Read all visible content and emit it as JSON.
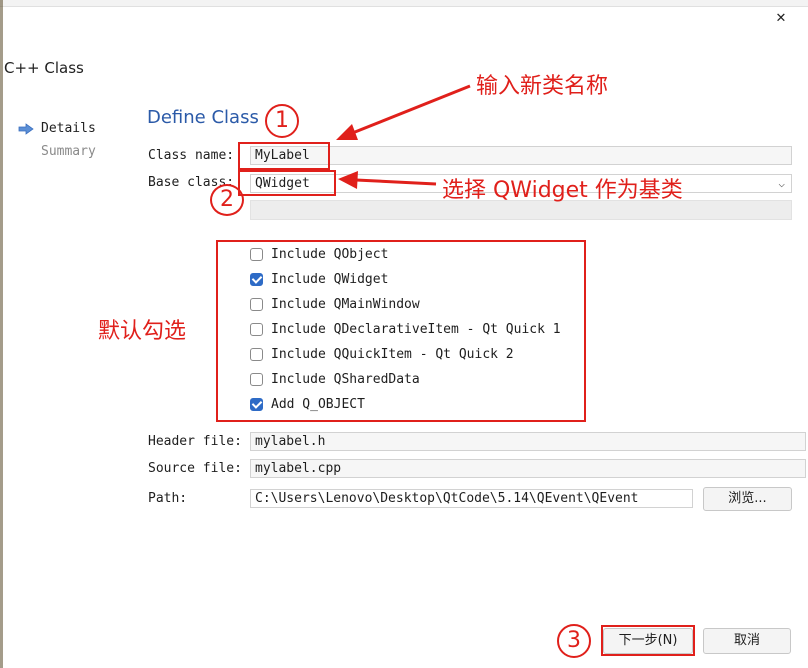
{
  "window": {
    "title": "C++ Class",
    "close_glyph": "✕"
  },
  "nav": {
    "details": "Details",
    "summary": "Summary",
    "arrow_icon": "arrow-right-icon"
  },
  "heading": "Define Class",
  "class_name": {
    "label": "Class name:",
    "value": "MyLabel"
  },
  "base_class": {
    "label": "Base class:",
    "value": "QWidget",
    "arrow": "⌵"
  },
  "options": [
    {
      "label": "Include QObject",
      "checked": false
    },
    {
      "label": "Include QWidget",
      "checked": true
    },
    {
      "label": "Include QMainWindow",
      "checked": false
    },
    {
      "label": "Include QDeclarativeItem - Qt Quick 1",
      "checked": false
    },
    {
      "label": "Include QQuickItem - Qt Quick 2",
      "checked": false
    },
    {
      "label": "Include QSharedData",
      "checked": false
    },
    {
      "label": "Add Q_OBJECT",
      "checked": true
    }
  ],
  "header_file": {
    "label": "Header file:",
    "value": "mylabel.h"
  },
  "source_file": {
    "label": "Source file:",
    "value": "mylabel.cpp"
  },
  "path": {
    "label": "Path:",
    "value": "C:\\Users\\Lenovo\\Desktop\\QtCode\\5.14\\QEvent\\QEvent",
    "browse": "浏览..."
  },
  "buttons": {
    "next": "下一步(N)",
    "cancel": "取消"
  },
  "annotations": {
    "note1": "输入新类名称",
    "note2": "选择 QWidget 作为基类",
    "note3": "默认勾选",
    "num1": "1",
    "num2": "2",
    "num3": "3",
    "color": "#e0201b"
  },
  "colors": {
    "accent": "#2b5aa8",
    "checkbox": "#2e6bc6"
  }
}
